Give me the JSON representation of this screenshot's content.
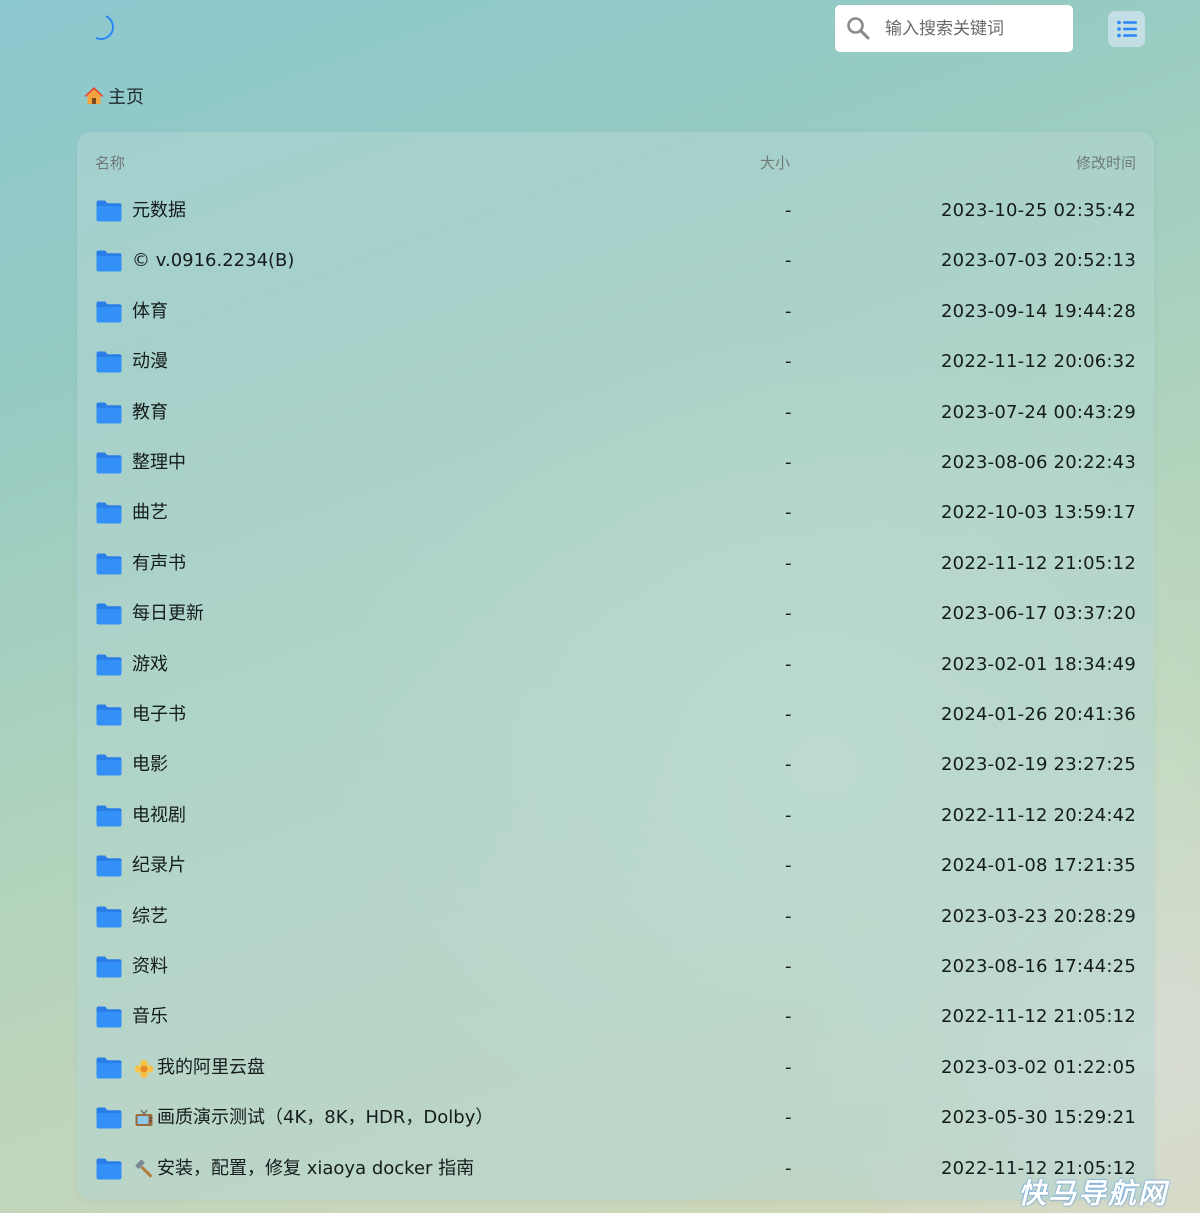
{
  "search": {
    "placeholder": "输入搜索关键词"
  },
  "breadcrumb": {
    "home_label": "主页"
  },
  "table": {
    "headers": {
      "name": "名称",
      "size": "大小",
      "modified": "修改时间"
    },
    "rows": [
      {
        "name": "元数据",
        "size": "-",
        "modified": "2023-10-25 02:35:42"
      },
      {
        "name": "© v.0916.2234(B)",
        "size": "-",
        "modified": "2023-07-03 20:52:13"
      },
      {
        "name": "体育",
        "size": "-",
        "modified": "2023-09-14 19:44:28"
      },
      {
        "name": "动漫",
        "size": "-",
        "modified": "2022-11-12 20:06:32"
      },
      {
        "name": "教育",
        "size": "-",
        "modified": "2023-07-24 00:43:29"
      },
      {
        "name": "整理中",
        "size": "-",
        "modified": "2023-08-06 20:22:43"
      },
      {
        "name": "曲艺",
        "size": "-",
        "modified": "2022-10-03 13:59:17"
      },
      {
        "name": "有声书",
        "size": "-",
        "modified": "2022-11-12 21:05:12"
      },
      {
        "name": "每日更新",
        "size": "-",
        "modified": "2023-06-17 03:37:20"
      },
      {
        "name": "游戏",
        "size": "-",
        "modified": "2023-02-01 18:34:49"
      },
      {
        "name": "电子书",
        "size": "-",
        "modified": "2024-01-26 20:41:36"
      },
      {
        "name": "电影",
        "size": "-",
        "modified": "2023-02-19 23:27:25"
      },
      {
        "name": "电视剧",
        "size": "-",
        "modified": "2022-11-12 20:24:42"
      },
      {
        "name": "纪录片",
        "size": "-",
        "modified": "2024-01-08 17:21:35"
      },
      {
        "name": "综艺",
        "size": "-",
        "modified": "2023-03-23 20:28:29"
      },
      {
        "name": "资料",
        "size": "-",
        "modified": "2023-08-16 17:44:25"
      },
      {
        "name": "音乐",
        "size": "-",
        "modified": "2022-11-12 21:05:12"
      },
      {
        "name": "我的阿里云盘",
        "size": "-",
        "modified": "2023-03-02 01:22:05",
        "emoji": "flower-icon"
      },
      {
        "name": "画质演示测试（4K，8K，HDR，Dolby）",
        "size": "-",
        "modified": "2023-05-30 15:29:21",
        "emoji": "tv-icon"
      },
      {
        "name": "安装，配置，修复 xiaoya docker 指南",
        "size": "-",
        "modified": "2022-11-12 21:05:12",
        "emoji": "hammer-icon"
      }
    ]
  },
  "watermark": {
    "text": "快马导航网"
  },
  "colors": {
    "accent": "#2b86f6",
    "folder": "#2f8cf6"
  }
}
